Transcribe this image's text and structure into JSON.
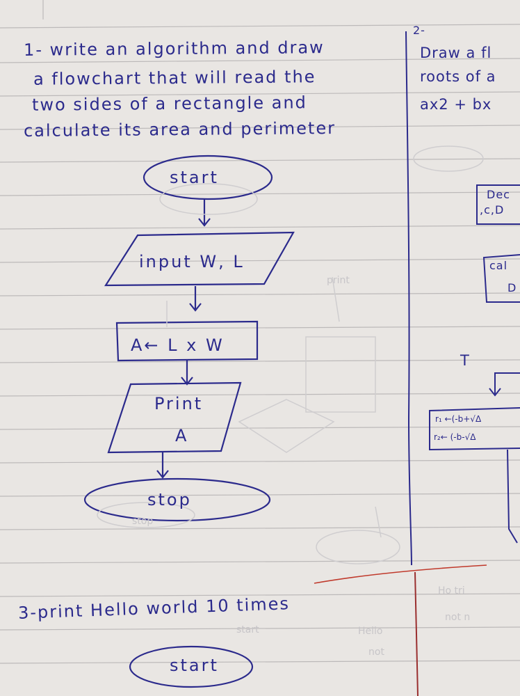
{
  "page": {
    "number_label": "2-"
  },
  "question1": {
    "lines": [
      "1- write an algorithm and draw",
      "a flowchart that will read the",
      "two sides of a rectangle and",
      "calculate its area and perimeter"
    ]
  },
  "flowchart1": {
    "start": "start",
    "input": "input W, L",
    "process": "A← L x W",
    "output_line1": "Print",
    "output_line2": "A",
    "stop": "stop"
  },
  "question2": {
    "lines": [
      "Draw a fl",
      "roots of a",
      "ax2 + bx"
    ],
    "box1": "Dec",
    "box1_sub": ",c,D",
    "box2": "cal",
    "box2_sub": "D",
    "true_label": "T",
    "r1": "r₁ ←(-b+√Δ",
    "r2": "r₂← (-b-√Δ"
  },
  "question3": {
    "title": "3-print Hello world 10 times",
    "start": "start"
  },
  "bleed_through": [
    "Ho tri",
    "not n",
    "not",
    "Hello",
    "start",
    "stop",
    "print"
  ],
  "colors": {
    "ink": "#2b2a8c",
    "paper": "#e9e6e3",
    "rule": "#bcb9b9",
    "red_margin": "#c0392b"
  }
}
